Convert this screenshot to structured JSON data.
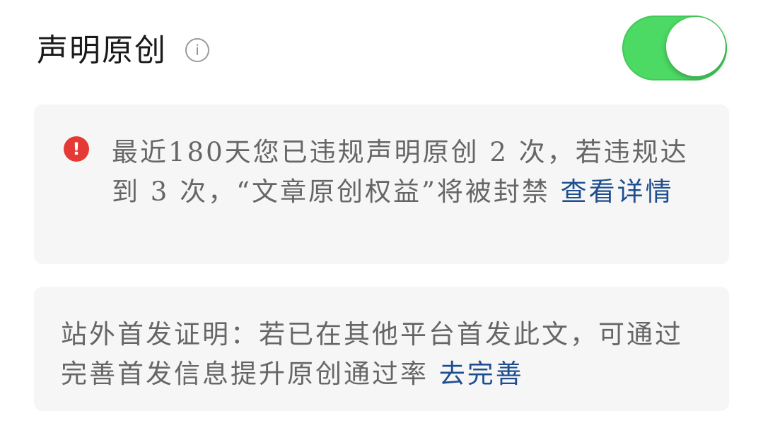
{
  "header": {
    "title": "声明原创",
    "info_icon": "info-icon",
    "toggle_on": true,
    "toggle_color": "#4cd964"
  },
  "warning": {
    "icon": "exclamation-icon",
    "icon_color": "#e53935",
    "text": "最近180天您已违规声明原创 2 次，若违规达到 3 次，“文章原创权益”将被封禁",
    "link": "查看详情",
    "link_color": "#1f4e8f"
  },
  "proof": {
    "text": "站外首发证明：若已在其他平台首发此文，可通过完善首发信息提升原创通过率",
    "link": "去完善"
  }
}
